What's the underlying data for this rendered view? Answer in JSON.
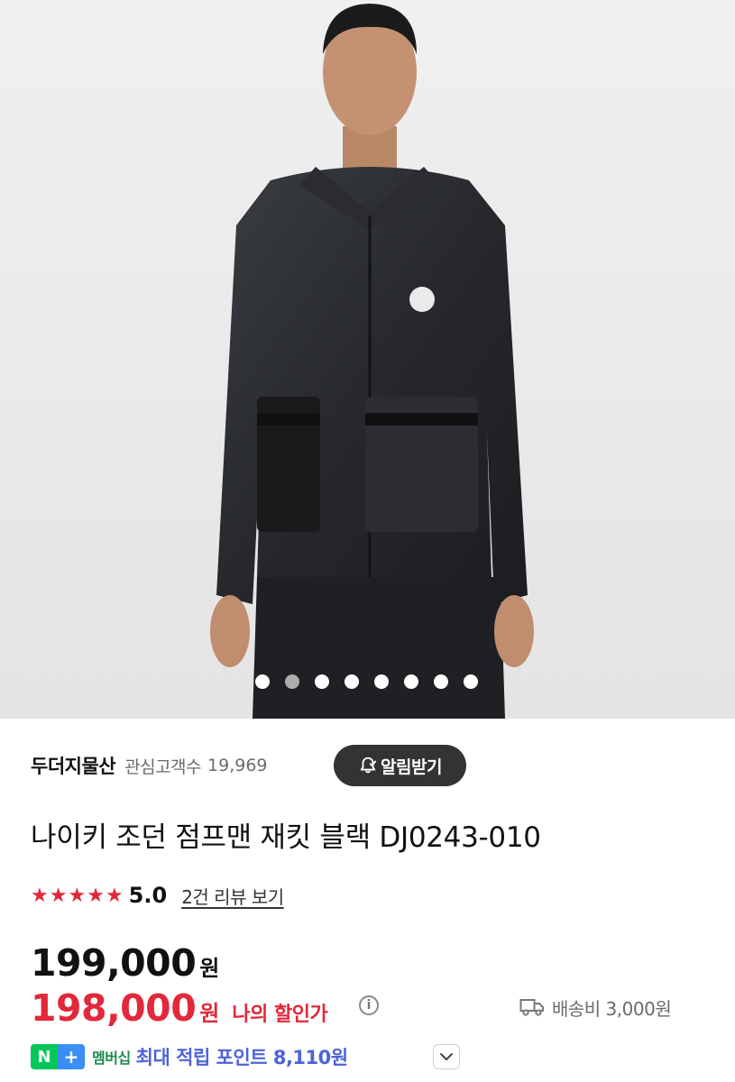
{
  "gallery": {
    "total_dots": 8,
    "active_index": 1
  },
  "store": {
    "name": "두더지물산",
    "fans_label": "관심고객수",
    "fans_count": "19,969",
    "alarm_button": "알림받기"
  },
  "product": {
    "title": "나이키 조던 점프맨 재킷 블랙 DJ0243-010",
    "rating": {
      "stars": 5,
      "score": "5.0",
      "review_link": "2건 리뷰 보기"
    },
    "original_price": "199,000",
    "currency": "원",
    "sale_price": "198,000",
    "sale_label": "나의 할인가",
    "shipping": "배송비 3,000원",
    "membership_badge": "멤버십",
    "membership_text": "최대 적립 포인트 8,110원"
  },
  "colors": {
    "accent_red": "#e2283b",
    "membership_blue": "#4d64d6",
    "naver_green": "#03c75a",
    "button_dark": "#333333"
  },
  "icons": [
    "bell-icon",
    "star-icon",
    "info-icon",
    "truck-icon",
    "chevron-down-icon",
    "naver-plus-icon"
  ]
}
